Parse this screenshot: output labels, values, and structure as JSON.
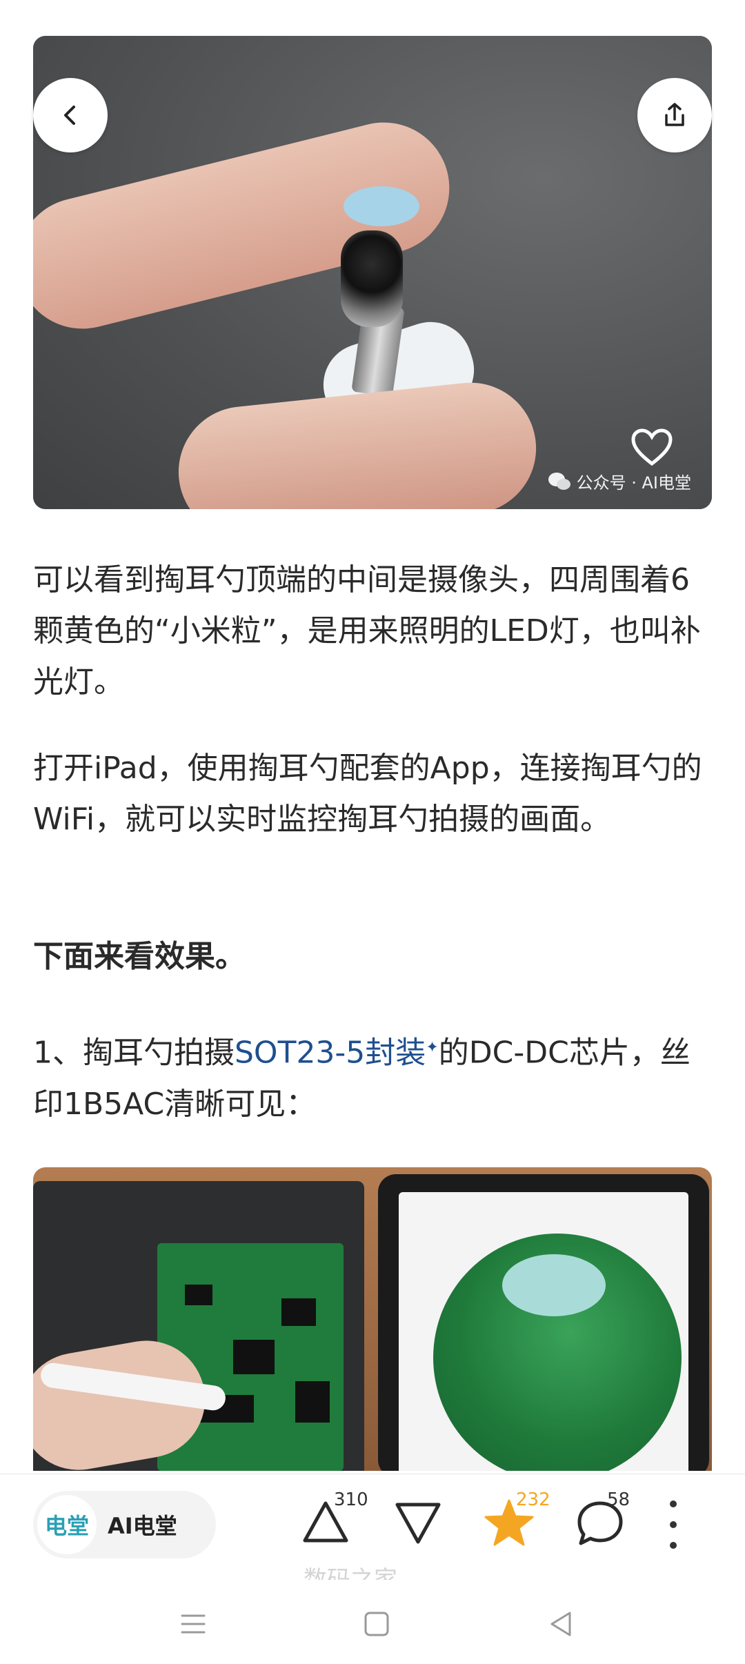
{
  "hero": {
    "watermark": "公众号 · AI电堂"
  },
  "article": {
    "p1": "可以看到掏耳勺顶端的中间是摄像头，四周围着6颗黄色的“小米粒”，是用来照明的LED灯，也叫补光灯。",
    "p2": "打开iPad，使用掏耳勺配套的App，连接掏耳勺的WiFi，就可以实时监控掏耳勺拍摄的画面。",
    "p3": "下面来看效果。",
    "p4_before": "1、掏耳勺拍摄",
    "p4_link": "SOT23-5封装",
    "p4_after": "的DC-DC芯片，丝印1B5AC清晰可见："
  },
  "bottom_bar": {
    "author_logo": "电堂",
    "author_name": "AI电堂",
    "upvote_count": "310",
    "favorite_count": "232",
    "comment_count": "58",
    "favorite_color": "#f4a623"
  },
  "site_watermark": "数码之家"
}
